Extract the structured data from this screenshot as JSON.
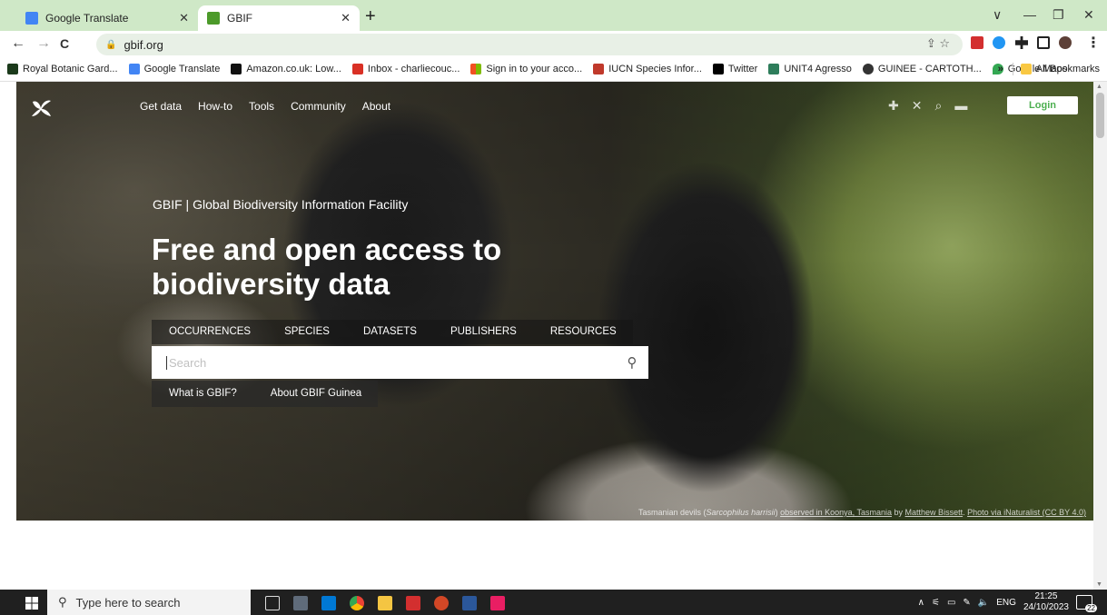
{
  "browser": {
    "tabs": [
      {
        "title": "Google Translate",
        "active": false,
        "favicon_color": "#4285f4"
      },
      {
        "title": "GBIF",
        "active": true,
        "favicon_color": "#4c9a2a"
      }
    ],
    "new_tab": "+",
    "window_controls": {
      "chevron": "∨",
      "minimize": "—",
      "restore": "❐",
      "close": "✕"
    },
    "nav": {
      "back": "←",
      "forward": "→",
      "reload": "C"
    },
    "url": "gbif.org",
    "bookmarks": [
      {
        "label": "Royal Botanic Gard...",
        "color": "#1b3a1b"
      },
      {
        "label": "Google Translate",
        "color": "#4285f4"
      },
      {
        "label": "Amazon.co.uk: Low...",
        "color": "#111111"
      },
      {
        "label": "Inbox - charliecouc...",
        "color": "#d93025"
      },
      {
        "label": "Sign in to your acco...",
        "color": "#f25022"
      },
      {
        "label": "IUCN Species Infor...",
        "color": "#c0392b"
      },
      {
        "label": "Twitter",
        "color": "#000000"
      },
      {
        "label": "UNIT4 Agresso",
        "color": "#2e7d5b"
      },
      {
        "label": "GUINEE - CARTOTH...",
        "color": "#333333"
      },
      {
        "label": "Google Maps",
        "color": "#34a853"
      }
    ],
    "bookmarks_overflow": "»",
    "all_bookmarks": "All Bookmarks"
  },
  "site": {
    "nav": [
      "Get data",
      "How-to",
      "Tools",
      "Community",
      "About"
    ],
    "login": "Login",
    "tagline": "GBIF | Global Biodiversity Information Facility",
    "headline": "Free and open access to biodiversity data",
    "categories": [
      "OCCURRENCES",
      "SPECIES",
      "DATASETS",
      "PUBLISHERS",
      "RESOURCES"
    ],
    "search": {
      "placeholder": "Search",
      "value": ""
    },
    "sublinks": [
      "What is GBIF?",
      "About GBIF Guinea"
    ],
    "credit": {
      "species": "Tasmanian devils",
      "scientific": "Sarcophilus harrisii",
      "observed": "observed in Koonya, Tasmania",
      "by": "by",
      "author": "Matthew Bissett",
      "sep": ".",
      "source": "Photo via iNaturalist (CC BY 4.0)"
    }
  },
  "taskbar": {
    "search_placeholder": "Type here to search",
    "language": "ENG",
    "time": "21:25",
    "date": "24/10/2023",
    "notifications": "22"
  }
}
